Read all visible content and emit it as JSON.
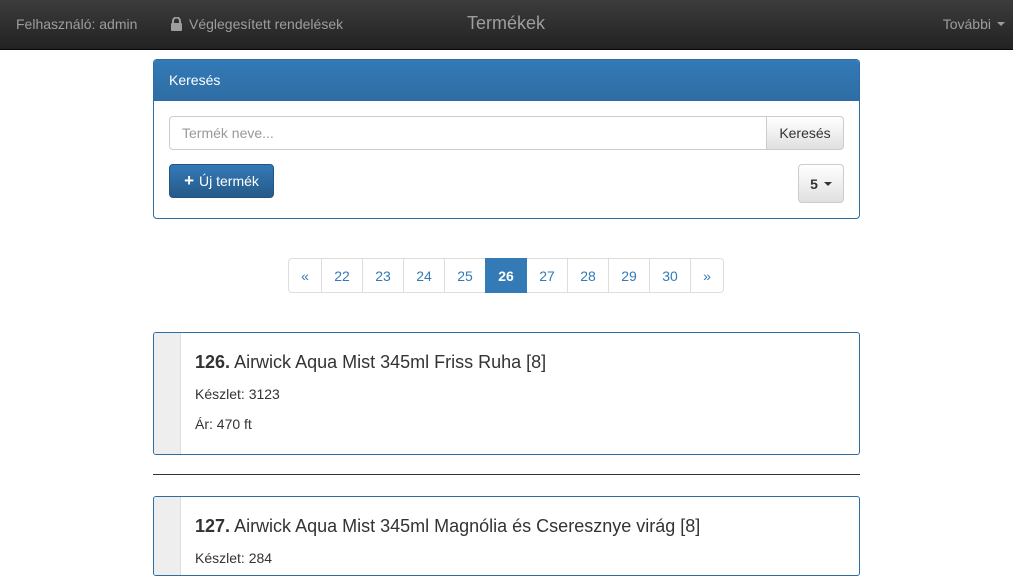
{
  "navbar": {
    "user": "Felhasználó: admin",
    "orders": "Véglegesített rendelések",
    "brand": "Termékek",
    "more": "További"
  },
  "search_panel": {
    "heading": "Keresés",
    "input_placeholder": "Termék neve...",
    "input_value": "",
    "search_button": "Keresés",
    "new_button": "Új termék",
    "page_size": "5"
  },
  "pagination": {
    "prev": "«",
    "pages": [
      "22",
      "23",
      "24",
      "25",
      "26",
      "27",
      "28",
      "29",
      "30"
    ],
    "active": "26",
    "next": "»"
  },
  "products": [
    {
      "number": "126.",
      "name": "Airwick Aqua Mist 345ml Friss Ruha [8]",
      "stock": "Készlet: 3123",
      "price": "Ár: 470 ft"
    },
    {
      "number": "127.",
      "name": "Airwick Aqua Mist 345ml Magnólia és Cseresznye virág [8]",
      "stock": "Készlet: 284"
    }
  ],
  "colors": {
    "navbar_bg": "#222222",
    "primary": "#337ab7",
    "link": "#337ab7"
  }
}
